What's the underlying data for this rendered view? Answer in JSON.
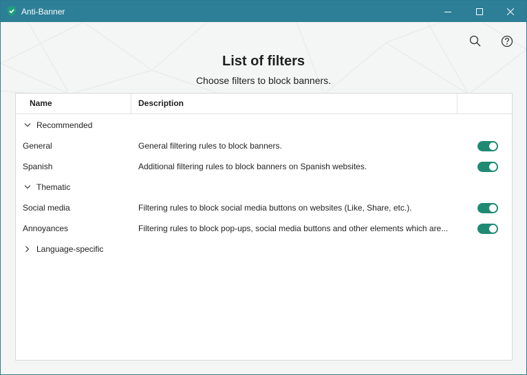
{
  "window": {
    "title": "Anti-Banner",
    "accent_color": "#2c7f96"
  },
  "toolbar": {
    "search_icon": "search-icon",
    "help_icon": "help-icon"
  },
  "header": {
    "title": "List of filters",
    "subtitle": "Choose filters to block banners."
  },
  "table": {
    "columns": [
      "Name",
      "Description"
    ],
    "groups": [
      {
        "label": "Recommended",
        "expanded": true,
        "filters": [
          {
            "name": "General",
            "description": "General filtering rules to block banners.",
            "enabled": true
          },
          {
            "name": "Spanish",
            "description": "Additional filtering rules to block banners on Spanish websites.",
            "enabled": true
          }
        ]
      },
      {
        "label": "Thematic",
        "expanded": true,
        "filters": [
          {
            "name": "Social media",
            "description": "Filtering rules to block social media buttons on websites (Like, Share, etc.).",
            "enabled": true
          },
          {
            "name": "Annoyances",
            "description": "Filtering rules to block pop-ups, social media buttons and other elements which are...",
            "enabled": true
          }
        ]
      },
      {
        "label": "Language-specific",
        "expanded": false,
        "filters": []
      }
    ],
    "toggle_on_color": "#1f8a73"
  }
}
